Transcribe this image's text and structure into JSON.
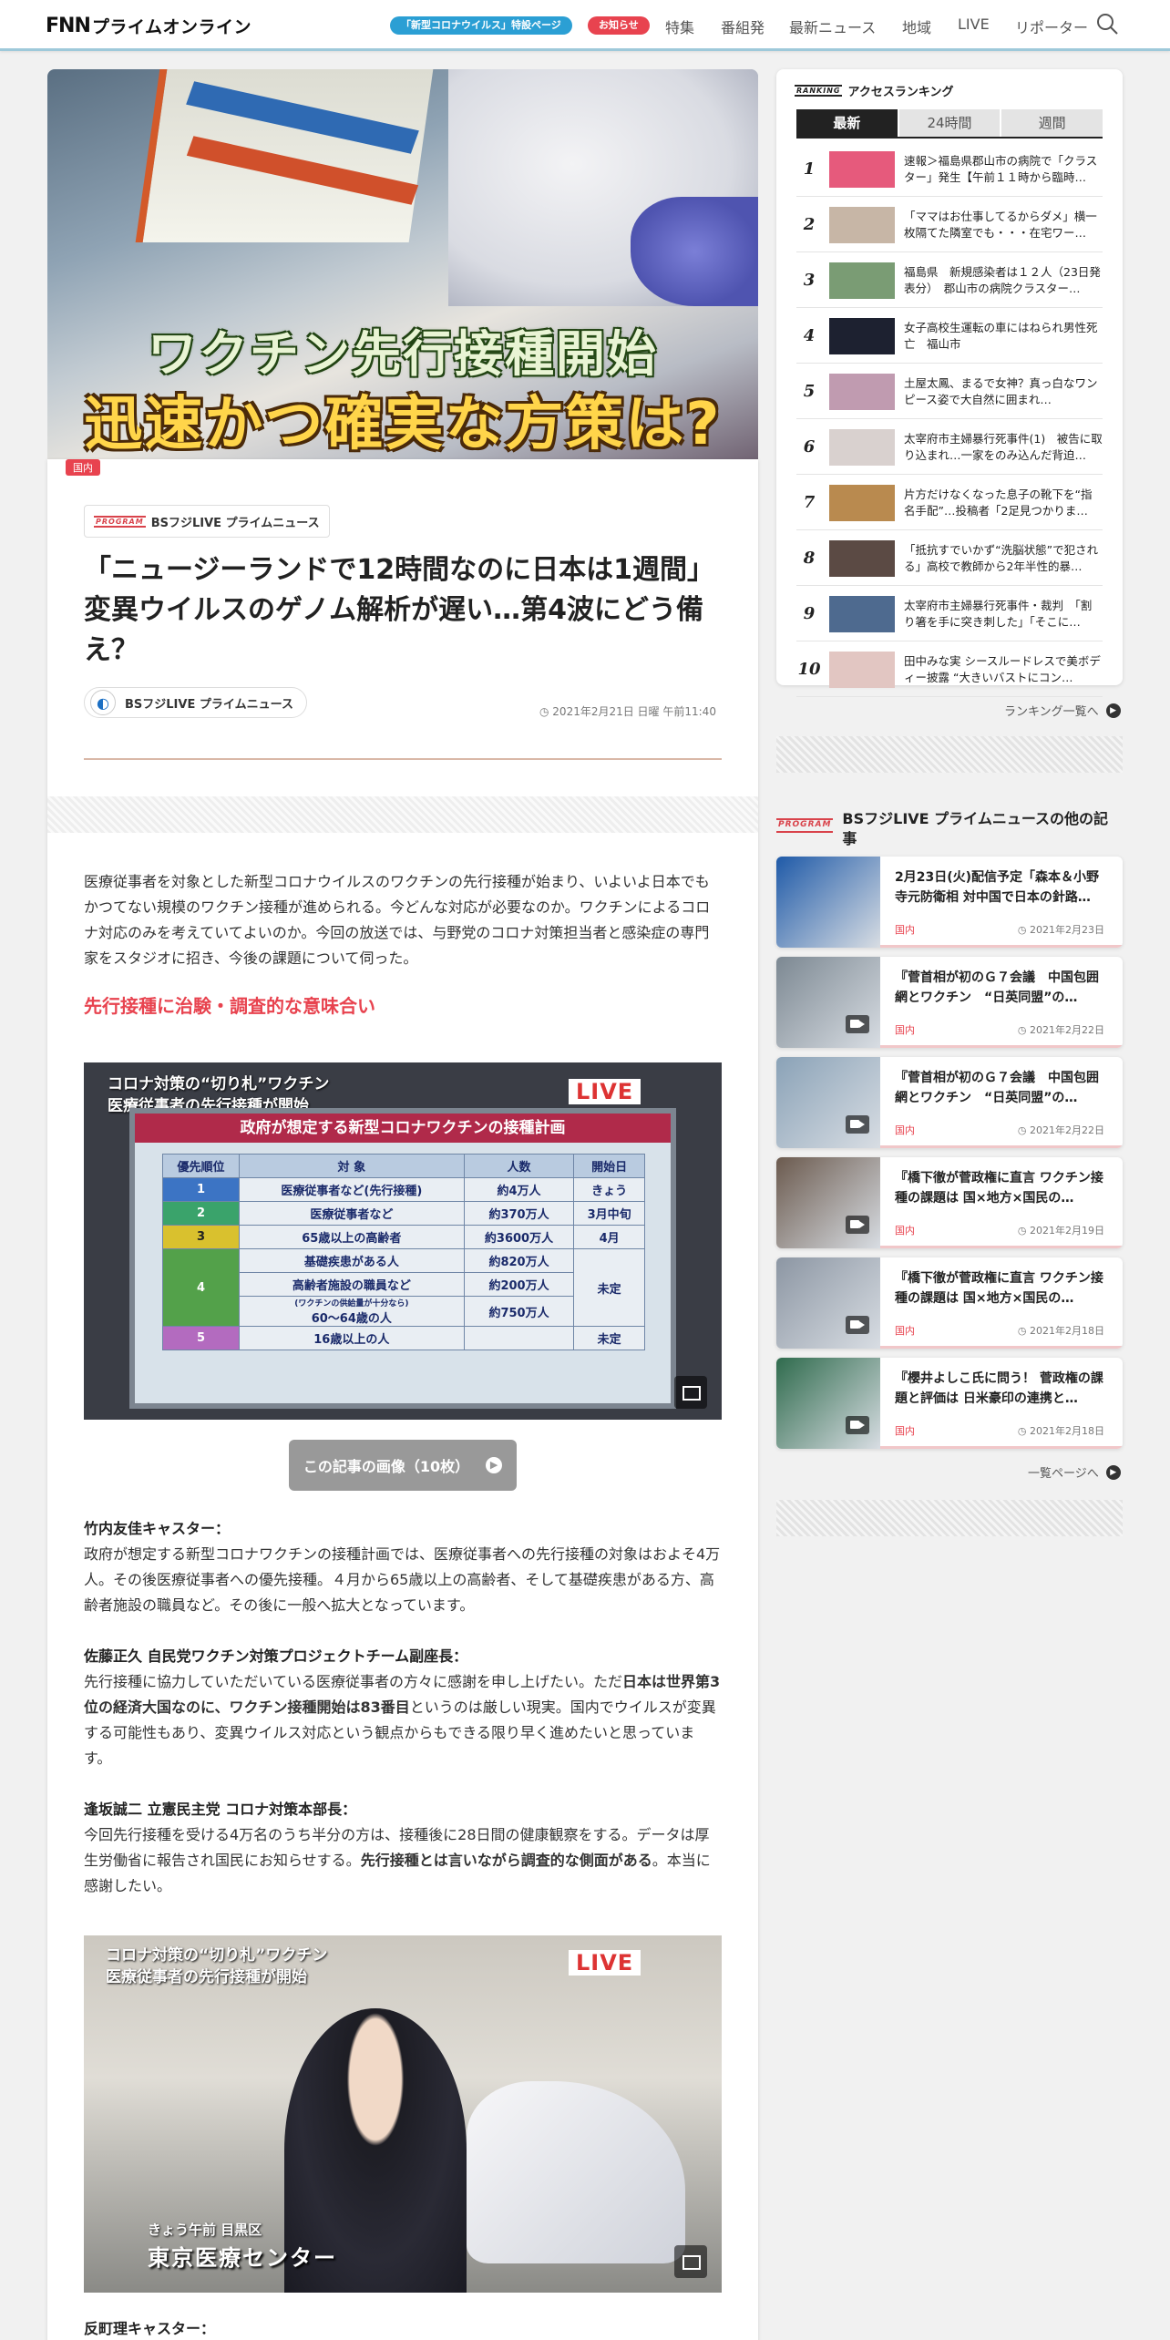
{
  "header": {
    "logo_prefix": "FNN",
    "logo_text": "プライムオンライン",
    "special_pill": "「新型コロナウイルス」特設ページ",
    "notice_pill": "お知らせ",
    "nav": [
      "特集",
      "番組発",
      "最新ニュース",
      "地域",
      "LIVE",
      "リポーター"
    ],
    "search_icon": "search-icon",
    "pill_color": "#2b9fd4",
    "notice_color": "#e8434f"
  },
  "hero": {
    "caption_line1": "ワクチン先行接種開始",
    "caption_line2": "迅速かつ確実な方策は?",
    "category": "国内"
  },
  "article": {
    "program_mini": "PROGRAM",
    "program_name": "BSフジLIVE プライムニュース",
    "title": "「ニュージーランドで12時間なのに日本は1週間」変異ウイルスのゲノム解析が遅い…第4波にどう備え？",
    "author": "BSフジLIVE プライムニュース",
    "date": "2021年2月21日 日曜 午前11:40",
    "intro": "医療従事者を対象とした新型コロナウイルスのワクチンの先行接種が始まり、いよいよ日本でもかつてない規模のワクチン接種が進められる。今どんな対応が必要なのか。ワクチンによるコロナ対応のみを考えていてよいのか。今回の放送では、与野党のコロナ対策担当者と感染症の専門家をスタジオに招き、今後の課題について伺った。",
    "subhead": "先行接種に治験・調査的な意味合い",
    "image1": {
      "caption1": "コロナ対策の“切り札”ワクチン",
      "caption2": "医療従事者の先行接種が開始",
      "live": "LIVE",
      "table_title": "政府が想定する新型コロナワクチンの接種計画",
      "headers": [
        "優先順位",
        "対 象",
        "人数",
        "開始日"
      ],
      "rows": [
        [
          "1",
          "医療従事者など(先行接種)",
          "約4万人",
          "きょう"
        ],
        [
          "2",
          "医療従事者など",
          "約370万人",
          "3月中旬"
        ],
        [
          "3",
          "65歳以上の高齢者",
          "約3600万人",
          "4月"
        ],
        [
          "4",
          "基礎疾患がある人",
          "約820万人",
          "未定"
        ],
        [
          "",
          "高齢者施設の職員など",
          "約200万人",
          ""
        ],
        [
          "",
          "60〜64歳の人",
          "約750万人",
          ""
        ],
        [
          "5",
          "16歳以上の人",
          "",
          "未定"
        ]
      ],
      "table_note": "(ワクチンの供給量が十分なら)"
    },
    "gallery_button": "この記事の画像（10枚）",
    "speaker1": "竹内友佳キャスター：",
    "para1": "政府が想定する新型コロナワクチンの接種計画では、医療従事者への先行接種の対象はおよそ4万人。その後医療従事者への優先接種。４月から65歳以上の高齢者、そして基礎疾患がある方、高齢者施設の職員など。その後に一般へ拡大となっています。",
    "speaker2": "佐藤正久 自民党ワクチン対策プロジェクトチーム副座長：",
    "para2a": "先行接種に協力していただいている医療従事者の方々に感謝を申し上げたい。ただ",
    "para2b": "日本は世界第3位の経済大国なのに、ワクチン接種開始は83番目",
    "para2c": "というのは厳しい現実。国内でウイルスが変異する可能性もあり、変異ウイルス対応という観点からもできる限り早く進めたいと思っています。",
    "speaker3": "逢坂誠二 立憲民主党 コロナ対策本部長：",
    "para3a": "今回先行接種を受ける4万名のうち半分の方は、接種後に28日間の健康観察をする。データは厚生労働省に報告され国民にお知らせする。",
    "para3b": "先行接種とは言いながら調査的な側面がある",
    "para3c": "。本当に感謝したい。",
    "image2": {
      "caption1": "コロナ対策の“切り札”ワクチン",
      "caption2": "医療従事者の先行接種が開始",
      "live": "LIVE",
      "loc1": "きょう午前 目黒区",
      "loc2": "東京医療センター"
    },
    "speaker4": "反町理キャスター："
  },
  "ranking": {
    "mini": "RANKING",
    "title": "アクセスランキング",
    "tabs": [
      "最新",
      "24時間",
      "週間"
    ],
    "items": [
      {
        "n": "1",
        "text": "速報＞福島県郡山市の病院で「クラスター」発生【午前１１時から臨時…",
        "c": "#e65a7c"
      },
      {
        "n": "2",
        "text": "「ママはお仕事してるからダメ」横一枚隔てた隣室でも・・・在宅ワー…",
        "c": "#c7b6a6"
      },
      {
        "n": "3",
        "text": "福島県　新規感染者は１２人（23日発表分）　郡山市の病院クラスター…",
        "c": "#7a9c74"
      },
      {
        "n": "4",
        "text": "女子高校生運転の車にはねられ男性死亡　福山市",
        "c": "#1d2130"
      },
      {
        "n": "5",
        "text": "土屋太鳳、まるで女神？真っ白なワンピース姿で大自然に囲まれ…",
        "c": "#c09bb0"
      },
      {
        "n": "6",
        "text": "太宰府市主婦暴行死事件(1)　被告に取り込まれ…一家をのみ込んだ背迫…",
        "c": "#d9d1cf"
      },
      {
        "n": "7",
        "text": "片方だけなくなった息子の靴下を“指名手配”…投稿者「2足見つかりま…",
        "c": "#b98a4f"
      },
      {
        "n": "8",
        "text": "「抵抗すでいかず“洗脳状態”で犯される」高校で教師から2年半性的暴…",
        "c": "#5b4a44"
      },
      {
        "n": "9",
        "text": "太宰府市主婦暴行死事件・裁判　「割り箸を手に突き刺した」「そこに…",
        "c": "#4e6a8f"
      },
      {
        "n": "10",
        "text": "田中みな実 シースルードレスで美ボディー披露 “大きいバストにコン…",
        "c": "#e2c6c2"
      }
    ],
    "more": "ランキング一覧へ"
  },
  "other": {
    "mini": "PROGRAM",
    "title": "BSフジLIVE プライムニュースの他の記事",
    "items": [
      {
        "text": "2月23日(火)配信予定「森本＆小野寺元防衛相 対中国で日本の針路…",
        "tag": "国内",
        "date": "2021年2月23日",
        "c": "#1f5aa8",
        "video": false
      },
      {
        "text": "『菅首相が初のＧ７会議　中国包囲網とワクチン　“日英同盟”の…",
        "tag": "国内",
        "date": "2021年2月22日",
        "c": "#7c8892",
        "video": true
      },
      {
        "text": "『菅首相が初のＧ７会議　中国包囲網とワクチン　“日英同盟”の…",
        "tag": "国内",
        "date": "2021年2月22日",
        "c": "#8aa2b7",
        "video": true
      },
      {
        "text": "『橋下徹が菅政権に直言 ワクチン接種の課題は 国×地方×国民の…",
        "tag": "国内",
        "date": "2021年2月19日",
        "c": "#6b5a4e",
        "video": true
      },
      {
        "text": "『橋下徹が菅政権に直言 ワクチン接種の課題は 国×地方×国民の…",
        "tag": "国内",
        "date": "2021年2月18日",
        "c": "#8c96a3",
        "video": true
      },
      {
        "text": "『櫻井よしこ氏に問う！ 菅政権の課題と評価は 日米豪印の連携と…",
        "tag": "国内",
        "date": "2021年2月18日",
        "c": "#2f6b4d",
        "video": true
      }
    ],
    "more": "一覧ページへ"
  }
}
